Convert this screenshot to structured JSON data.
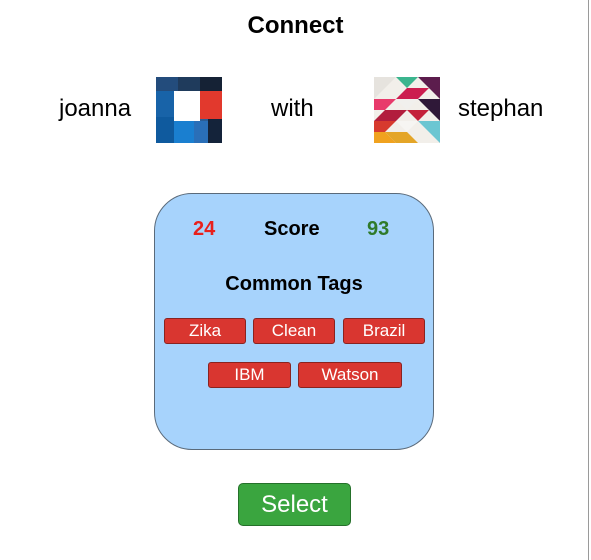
{
  "title": "Connect",
  "users": {
    "left": {
      "name": "joanna",
      "avatar_icon": "blue-red-checker-avatar-icon"
    },
    "connector": "with",
    "right": {
      "name": "stephan",
      "avatar_icon": "colorful-diagonal-pattern-avatar-icon"
    }
  },
  "card": {
    "left_score": "24",
    "score_label": "Score",
    "right_score": "93",
    "tags_title": "Common Tags",
    "tags": [
      "Zika",
      "Clean",
      "Brazil",
      "IBM",
      "Watson"
    ]
  },
  "select_label": "Select",
  "colors": {
    "card_bg": "#a7d3fc",
    "tag_bg": "#d93630",
    "left_score": "#e8201c",
    "right_score": "#2f7a2a",
    "select_bg": "#3aa53f"
  }
}
